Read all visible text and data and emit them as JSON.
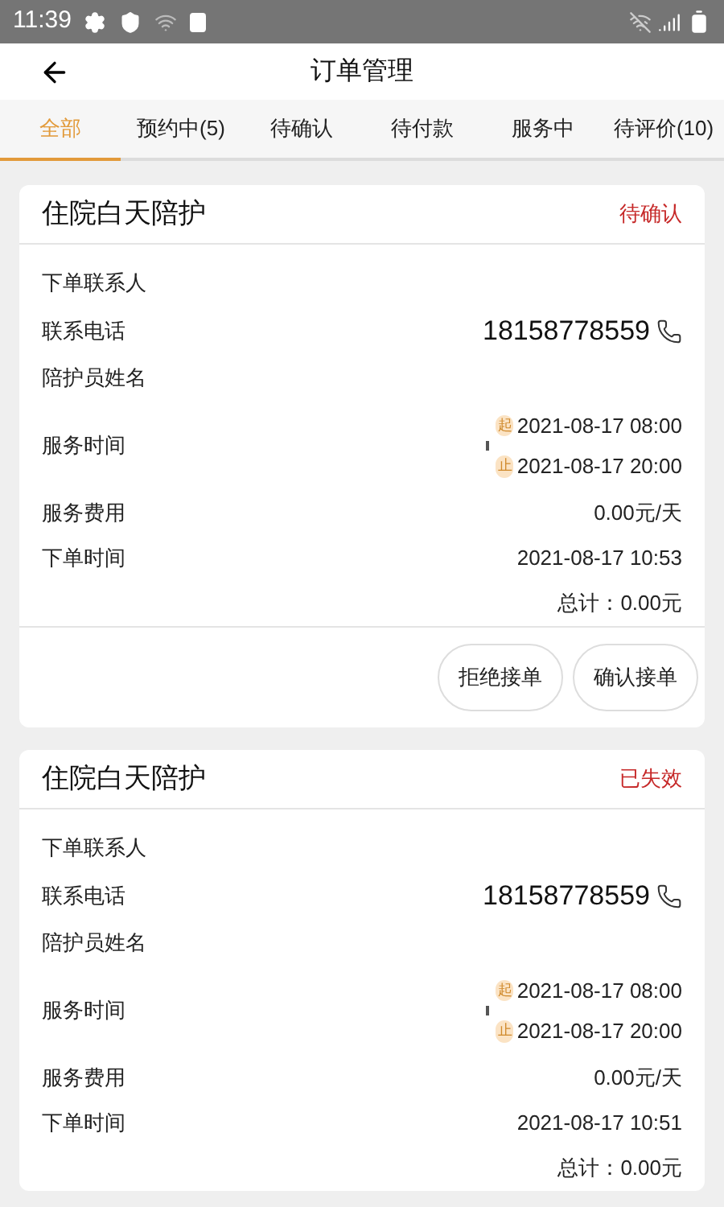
{
  "status_bar": {
    "time": "11:39"
  },
  "header": {
    "title": "订单管理"
  },
  "tabs": [
    {
      "label": "全部",
      "selected": true
    },
    {
      "label": "预约中(5)",
      "selected": false
    },
    {
      "label": "待确认",
      "selected": false
    },
    {
      "label": "待付款",
      "selected": false
    },
    {
      "label": "服务中",
      "selected": false
    },
    {
      "label": "待评价(10)",
      "selected": false
    }
  ],
  "orders": [
    {
      "title": "住院白天陪护",
      "status": "待确认",
      "rows": [
        {
          "kind": "text",
          "label": "下单联系人"
        },
        {
          "kind": "phone",
          "label": "联系电话",
          "value": "18158778559"
        },
        {
          "kind": "text",
          "label": "陪护员姓名"
        },
        {
          "kind": "time",
          "label": "服务时间",
          "start_mark": "起",
          "start": "2021-08-17 08:00",
          "end_mark": "止",
          "end": "2021-08-17 20:00"
        },
        {
          "kind": "text",
          "label": "服务费用",
          "value": "0.00元/天"
        },
        {
          "kind": "text",
          "label": "下单时间",
          "value": "2021-08-17 10:53"
        }
      ],
      "total": "总计：0.00元",
      "buttons": [
        "拒绝接单",
        "确认接单"
      ]
    },
    {
      "title": "住院白天陪护",
      "status": "已失效",
      "rows": [
        {
          "kind": "text",
          "label": "下单联系人"
        },
        {
          "kind": "phone",
          "label": "联系电话",
          "value": "18158778559"
        },
        {
          "kind": "text",
          "label": "陪护员姓名"
        },
        {
          "kind": "time",
          "label": "服务时间",
          "start_mark": "起",
          "start": "2021-08-17 08:00",
          "end_mark": "止",
          "end": "2021-08-17 20:00"
        },
        {
          "kind": "text",
          "label": "服务费用",
          "value": "0.00元/天"
        },
        {
          "kind": "text",
          "label": "下单时间",
          "value": "2021-08-17 10:51"
        }
      ],
      "total": "总计：0.00元"
    }
  ]
}
